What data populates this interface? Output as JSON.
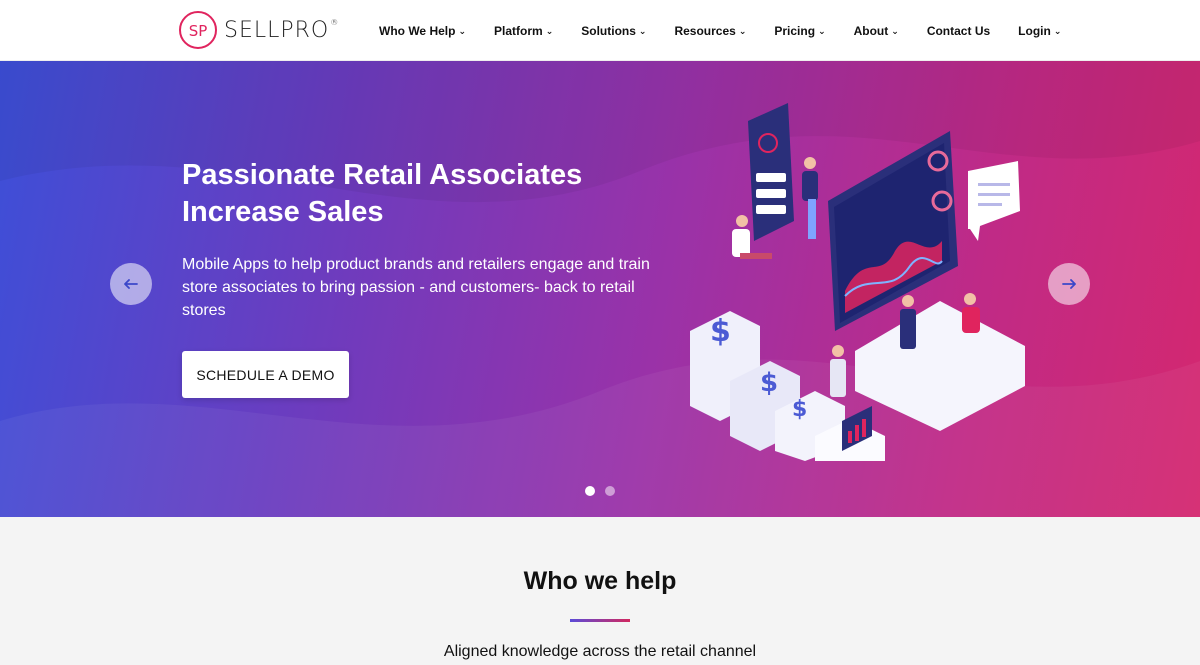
{
  "brand": {
    "logo_initials": "SP",
    "logo_text": "SELLPRO",
    "logo_reg": "®",
    "accent_color": "#e0245e"
  },
  "nav": {
    "items": [
      {
        "label": "Who We Help",
        "has_dropdown": true
      },
      {
        "label": "Platform",
        "has_dropdown": true
      },
      {
        "label": "Solutions",
        "has_dropdown": true
      },
      {
        "label": "Resources",
        "has_dropdown": true
      },
      {
        "label": "Pricing",
        "has_dropdown": true
      },
      {
        "label": "About",
        "has_dropdown": true
      },
      {
        "label": "Contact Us",
        "has_dropdown": false
      },
      {
        "label": "Login",
        "has_dropdown": true
      }
    ],
    "chevron": "⌄"
  },
  "hero": {
    "title_line1": "Passionate Retail Associates",
    "title_line2": "Increase Sales",
    "subtitle": "Mobile Apps to help product brands and retailers engage and train store associates to bring passion - and customers- back to retail stores",
    "cta_label": "SCHEDULE A DEMO",
    "prev_icon": "arrow-left-icon",
    "next_icon": "arrow-right-icon",
    "slide_count": 2,
    "active_slide": 1,
    "gradient_colors": [
      "#3d4fd8",
      "#9a32a8",
      "#d4286f"
    ]
  },
  "who_we_help": {
    "title": "Who we help",
    "subtitle": "Aligned knowledge across the retail channel"
  }
}
